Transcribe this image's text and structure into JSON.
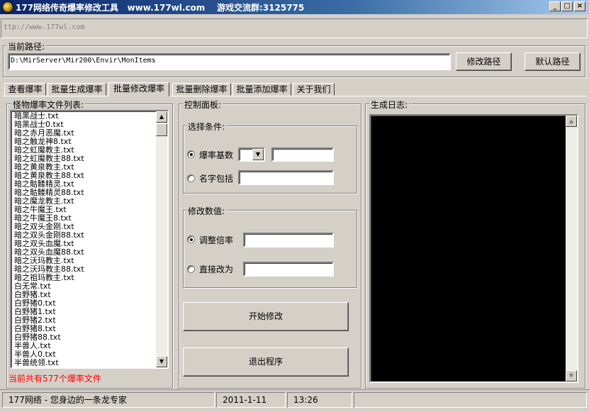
{
  "window": {
    "title": "177网络传奇爆率修改工具   www.177wl.com    游戏交流群:3125775",
    "minimize": "_",
    "maximize": "□",
    "close": "×"
  },
  "url_bar": {
    "text": "ttp://www.177wl.com"
  },
  "path": {
    "label": "当前路径:",
    "value": "D:\\MirServer\\Mir200\\Envir\\MonItems",
    "modify_button": "修改路径",
    "default_button": "默认路径"
  },
  "tabs": [
    "查看爆率",
    "批量生成爆率",
    "批量修改爆率",
    "批量删除爆率",
    "批量添加爆率",
    "关于我们"
  ],
  "active_tab": "批量修改爆率",
  "file_list": {
    "label": "怪物爆率文件列表:",
    "items": [
      "暗黑战士.txt",
      "暗黑战士0.txt",
      "暗之赤月恶魔.txt",
      "暗之触龙神8.txt",
      "暗之虹魔教主.txt",
      "暗之虹魔教主88.txt",
      "暗之黄泉教主.txt",
      "暗之黄泉教主88.txt",
      "暗之骷髅精灵.txt",
      "暗之骷髅精灵88.txt",
      "暗之魔龙教主.txt",
      "暗之牛魔王.txt",
      "暗之牛魔王8.txt",
      "暗之双头金刚.txt",
      "暗之双头金刚88.txt",
      "暗之双头血魔.txt",
      "暗之双头血魔88.txt",
      "暗之沃玛教主.txt",
      "暗之沃玛教主88.txt",
      "暗之祖玛教主.txt",
      "白无常.txt",
      "白野猪.txt",
      "白野猪0.txt",
      "白野猪1.txt",
      "白野猪2.txt",
      "白野猪8.txt",
      "白野猪88.txt",
      "半兽人.txt",
      "半兽人0.txt",
      "半兽统领.txt"
    ],
    "count_text": "当前共有577个爆率文件"
  },
  "control": {
    "label": "控制面板:",
    "select": {
      "label": "选择条件:",
      "rate_base_label": "爆率基数",
      "rate_base_selected": "",
      "rate_base_value": "",
      "name_contains_label": "名字包括",
      "name_contains_value": ""
    },
    "modify": {
      "label": "修改数值:",
      "multiplier_label": "调整倍率",
      "multiplier_value": "",
      "direct_label": "直接改为",
      "direct_value": ""
    },
    "start_button": "开始修改",
    "exit_button": "退出程序"
  },
  "log": {
    "label": "生成日志:"
  },
  "status": {
    "company": "177网络 - 您身边的一条龙专家",
    "date": "2011-1-11",
    "time": "13:26"
  },
  "colors": {
    "title_bar": "#0a246a",
    "count_text": "#ff0000",
    "log_bg": "#000000"
  }
}
